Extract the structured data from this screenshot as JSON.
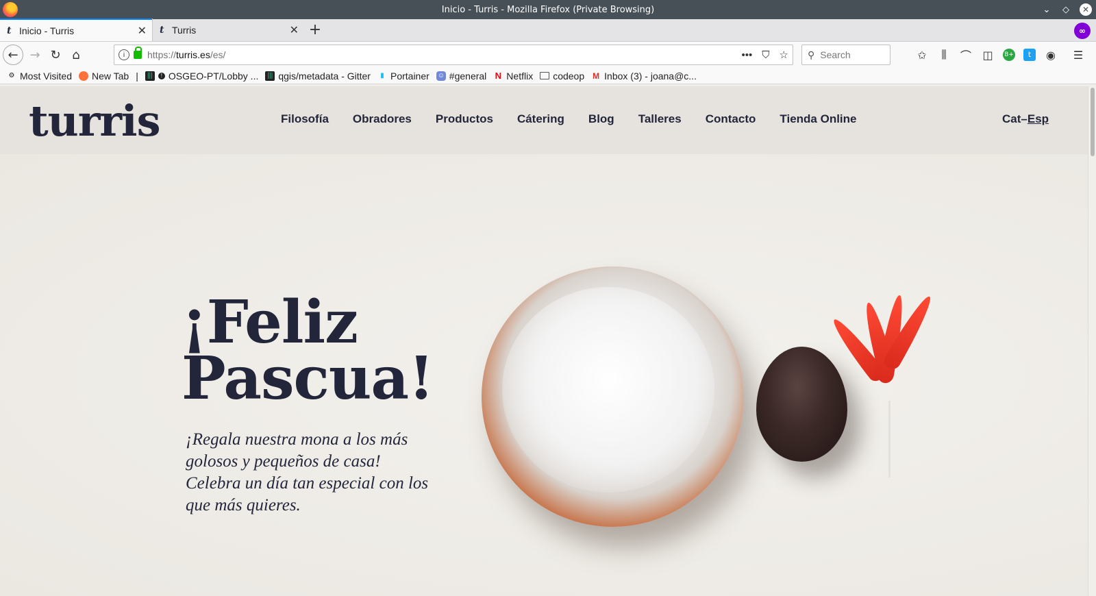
{
  "window": {
    "title": "Inicio - Turris - Mozilla Firefox (Private Browsing)"
  },
  "tabs": [
    {
      "label": "Inicio - Turris",
      "active": true
    },
    {
      "label": "Turris",
      "active": false
    }
  ],
  "urlbar": {
    "scheme": "https://",
    "host": "turris.es",
    "path": "/es/"
  },
  "search": {
    "placeholder": "Search"
  },
  "bookmarks": [
    {
      "label": "Most Visited",
      "icon": "gear-icon"
    },
    {
      "label": "New Tab",
      "icon": "firefox-icon"
    },
    {
      "label": "OSGEO-PT/Lobby ...",
      "icon": "gitter-icon"
    },
    {
      "label": "qgis/metadata - Gitter",
      "icon": "gitter-icon"
    },
    {
      "label": "Portainer",
      "icon": "portainer-icon"
    },
    {
      "label": "#general",
      "icon": "discord-icon"
    },
    {
      "label": "Netflix",
      "icon": "netflix-icon"
    },
    {
      "label": "codeop",
      "icon": "folder-icon"
    },
    {
      "label": "Inbox (3) - joana@c...",
      "icon": "gmail-icon"
    }
  ],
  "site": {
    "logo": "turris",
    "nav": [
      "Filosofía",
      "Obradores",
      "Productos",
      "Cátering",
      "Blog",
      "Talleres",
      "Contacto",
      "Tienda Online"
    ],
    "lang": {
      "cat": "Cat",
      "sep": "–",
      "esp": "Esp"
    },
    "hero": {
      "title_line1": "¡Feliz",
      "title_line2": "Pascua!",
      "text": "¡Regala nuestra mona a los más golosos y pequeños de casa! Celebra un día tan especial con los que más quieres."
    }
  },
  "colors": {
    "brand_navy": "#23263a",
    "titlebar": "#475057",
    "page_bg": "#f1efea",
    "header_bg": "#e6e3de",
    "feather_red": "#ff4a35"
  }
}
